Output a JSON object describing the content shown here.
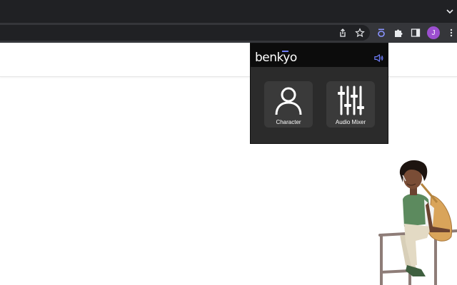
{
  "browser": {
    "profile_initial": "J",
    "icons": [
      "share-icon",
      "star-icon",
      "benkyo-extension-icon",
      "puzzle-icon",
      "side-panel-icon",
      "kebab-menu-icon"
    ]
  },
  "popup": {
    "logo_text": "benkyo",
    "tiles": [
      {
        "label": "Character",
        "icon": "person-icon"
      },
      {
        "label": "Audio Mixer",
        "icon": "sliders-icon"
      }
    ]
  },
  "colors": {
    "accent": "#6e7cf7",
    "popup_bg": "#2b2b2b",
    "tile_bg": "#3a3a3a",
    "toolbar_bg": "#35363a",
    "tabstrip_bg": "#202124",
    "avatar_bg": "#9c4fd0"
  }
}
